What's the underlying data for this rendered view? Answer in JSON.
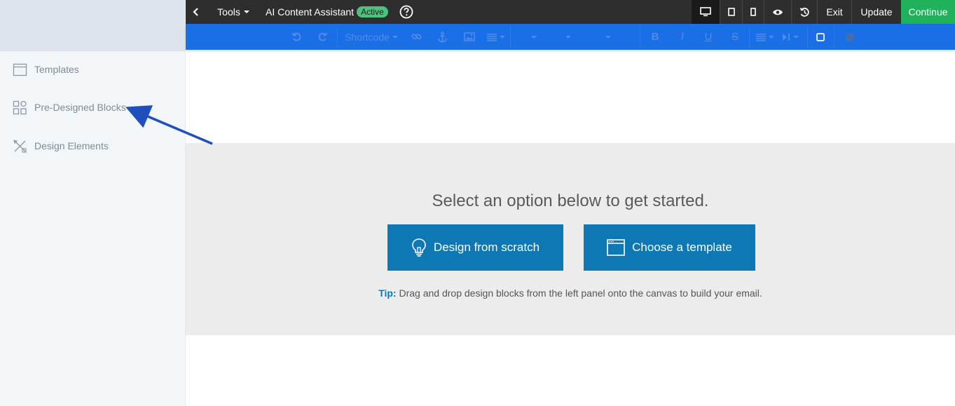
{
  "sidebar": {
    "items": [
      {
        "label": "Templates",
        "icon": "templates-icon"
      },
      {
        "label": "Pre-Designed Blocks",
        "icon": "blocks-grid-icon"
      },
      {
        "label": "Design Elements",
        "icon": "design-tools-icon"
      }
    ]
  },
  "topbar": {
    "back_icon": "chevron-left-icon",
    "tools_label": "Tools",
    "ai_label": "AI Content Assistant",
    "ai_status": "Active",
    "help_icon": "help-circle-icon",
    "view_icons": [
      "desktop-icon",
      "tablet-icon",
      "mobile-icon",
      "preview-eye-icon",
      "history-icon"
    ],
    "exit_label": "Exit",
    "update_label": "Update",
    "continue_label": "Continue",
    "continue_color": "#21b05c"
  },
  "editor_toolbar": {
    "shortcode_label": "Shortcode",
    "icons": [
      "undo-icon",
      "redo-icon",
      "link-icon",
      "anchor-icon",
      "image-icon",
      "align-icon",
      "bold-icon",
      "italic-icon",
      "underline-icon",
      "strikethrough-icon",
      "list-icon",
      "media-icon",
      "box-icon",
      "emoji-icon"
    ],
    "bar_color": "#1a6fe6"
  },
  "canvas": {
    "prompt": "Select an option below to get started.",
    "design_button": "Design from scratch",
    "template_button": "Choose a template",
    "tip_label": "Tip:",
    "tip_text": " Drag and drop design blocks from the left panel onto the canvas to build your email.",
    "button_color": "#0d78b3"
  },
  "annotation": {
    "arrow_color": "#1f4fbf"
  }
}
